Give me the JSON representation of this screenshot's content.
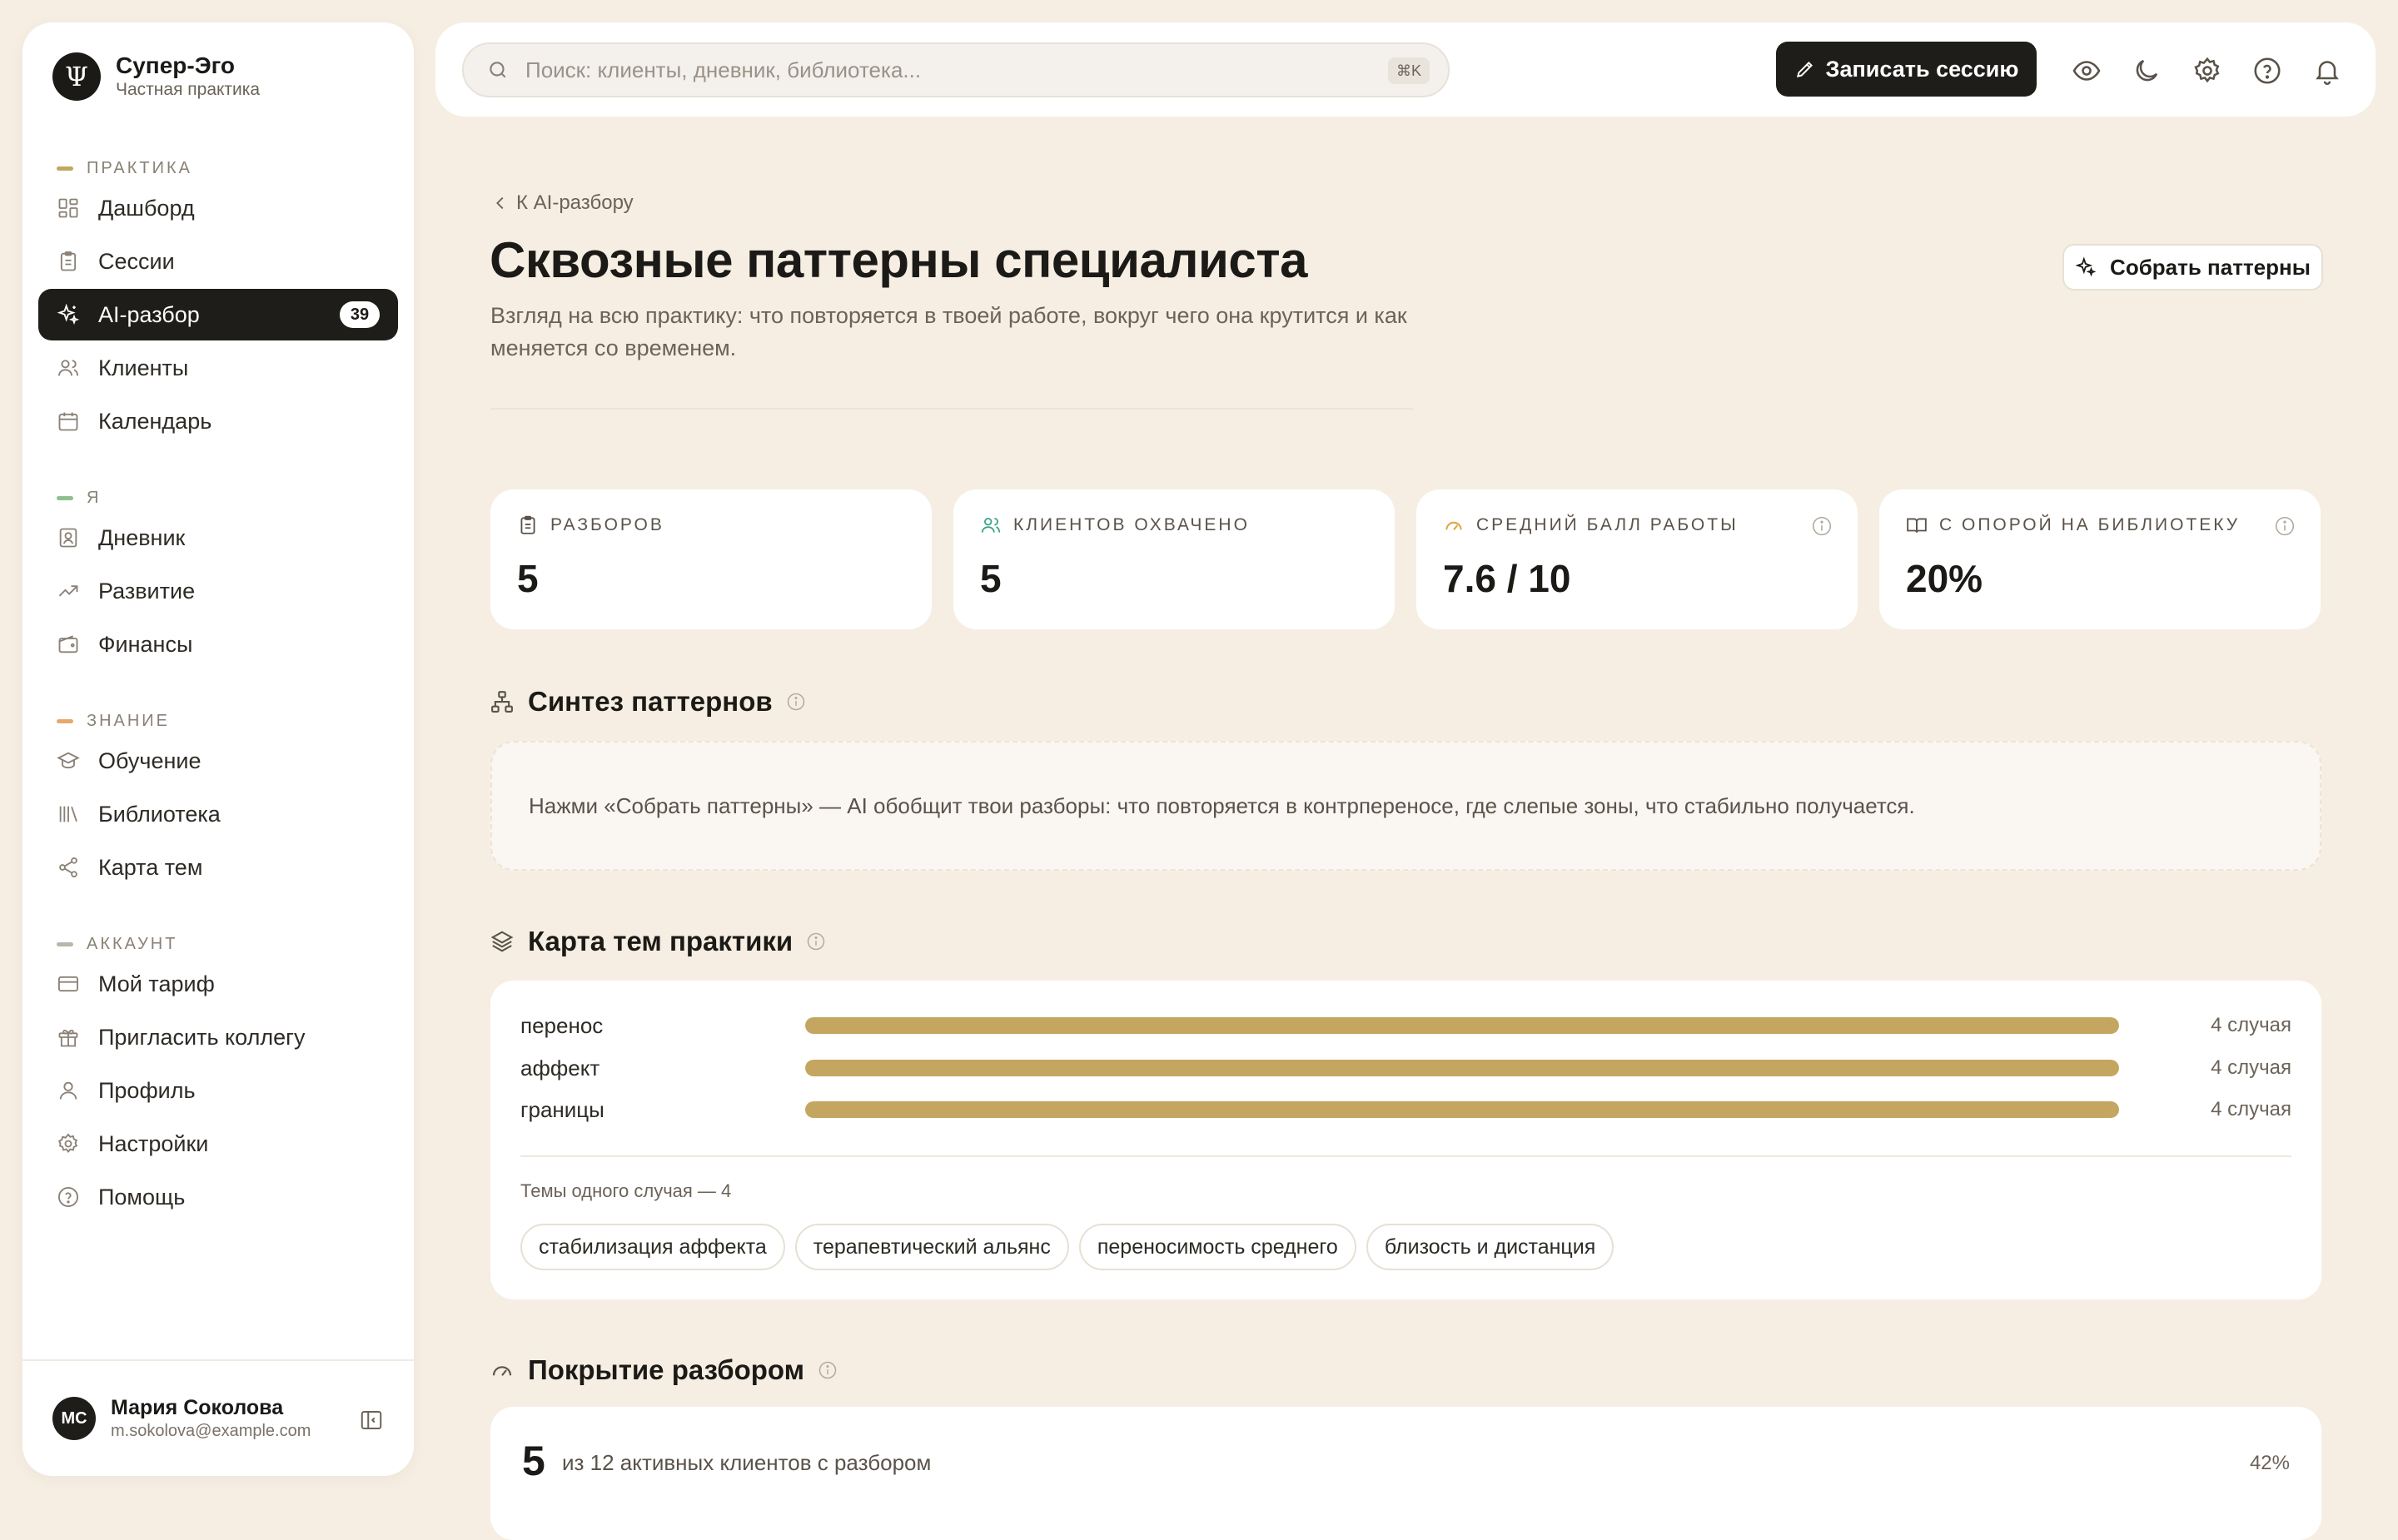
{
  "app": {
    "logo_glyph": "Ψ",
    "name": "Супер-Эго",
    "subtitle": "Частная практика"
  },
  "sidebar": {
    "sections": [
      {
        "label": "ПРАКТИКА",
        "color": "#c4a660",
        "items": [
          {
            "label": "Дашборд",
            "icon": "dashboard-icon"
          },
          {
            "label": "Сессии",
            "icon": "clipboard-icon"
          },
          {
            "label": "AI-разбор",
            "icon": "sparkles-icon",
            "active": true,
            "badge": "39"
          },
          {
            "label": "Клиенты",
            "icon": "users-icon"
          },
          {
            "label": "Календарь",
            "icon": "calendar-icon"
          }
        ]
      },
      {
        "label": "Я",
        "color": "#8fbf8f",
        "items": [
          {
            "label": "Дневник",
            "icon": "diary-icon"
          },
          {
            "label": "Развитие",
            "icon": "trending-up-icon"
          },
          {
            "label": "Финансы",
            "icon": "wallet-icon"
          }
        ]
      },
      {
        "label": "ЗНАНИЕ",
        "color": "#e6a96b",
        "items": [
          {
            "label": "Обучение",
            "icon": "graduation-cap-icon"
          },
          {
            "label": "Библиотека",
            "icon": "library-icon"
          },
          {
            "label": "Карта тем",
            "icon": "share-nodes-icon"
          }
        ]
      },
      {
        "label": "АККАУНТ",
        "color": "#bdb5aa",
        "items": [
          {
            "label": "Мой тариф",
            "icon": "credit-card-icon"
          },
          {
            "label": "Пригласить коллегу",
            "icon": "gift-icon"
          },
          {
            "label": "Профиль",
            "icon": "user-icon"
          },
          {
            "label": "Настройки",
            "icon": "gear-icon"
          },
          {
            "label": "Помощь",
            "icon": "help-circle-icon"
          }
        ]
      }
    ],
    "user": {
      "initials": "МС",
      "name": "Мария Соколова",
      "email": "m.sokolova@example.com"
    }
  },
  "topbar": {
    "search_placeholder": "Поиск: клиенты, дневник, библиотека...",
    "shortcut": "⌘K",
    "record_label": "Записать сессию",
    "icons": [
      "eye-icon",
      "moon-icon",
      "gear-icon",
      "help-circle-icon",
      "bell-icon"
    ]
  },
  "page": {
    "back_label": "К AI-разбору",
    "title": "Сквозные паттерны специалиста",
    "description": "Взгляд на всю практику: что повторяется в твоей работе, вокруг чего она крутится и как меняется со временем.",
    "collect_label": "Собрать паттерны"
  },
  "stats": [
    {
      "label": "РАЗБОРОВ",
      "value": "5",
      "icon": "clipboard-icon",
      "icon_color": "#5a5349",
      "info": false
    },
    {
      "label": "КЛИЕНТОВ ОХВАЧЕНО",
      "value": "5",
      "icon": "users-icon",
      "icon_color": "#3aa58a",
      "info": false
    },
    {
      "label": "СРЕДНИЙ БАЛЛ РАБОТЫ",
      "value": "7.6 / 10",
      "icon": "gauge-icon",
      "icon_color": "#e0a23a",
      "info": true
    },
    {
      "label": "С ОПОРОЙ НА БИБЛИОТЕКУ",
      "value": "20%",
      "icon": "book-open-icon",
      "icon_color": "#5a5349",
      "info": true
    }
  ],
  "synthesis": {
    "title": "Синтез паттернов",
    "hint": "Нажми «Собрать паттерны» — AI обобщит твои разборы: что повторяется в контрпереносе, где слепые зоны, что стабильно получается."
  },
  "themes": {
    "title": "Карта тем практики",
    "bar_color": "#c4a660",
    "rows": [
      {
        "name": "перенос",
        "fraction": 1.0,
        "count_label": "4 случая"
      },
      {
        "name": "аффект",
        "fraction": 1.0,
        "count_label": "4 случая"
      },
      {
        "name": "границы",
        "fraction": 1.0,
        "count_label": "4 случая"
      }
    ],
    "single_title": "Темы одного случая — 4",
    "single_chips": [
      "стабилизация аффекта",
      "терапевтический альянс",
      "переносимость среднего",
      "близость и дистанция"
    ]
  },
  "coverage": {
    "title": "Покрытие разбором",
    "number": "5",
    "text": "из 12 активных клиентов с разбором",
    "percent": "42%"
  }
}
